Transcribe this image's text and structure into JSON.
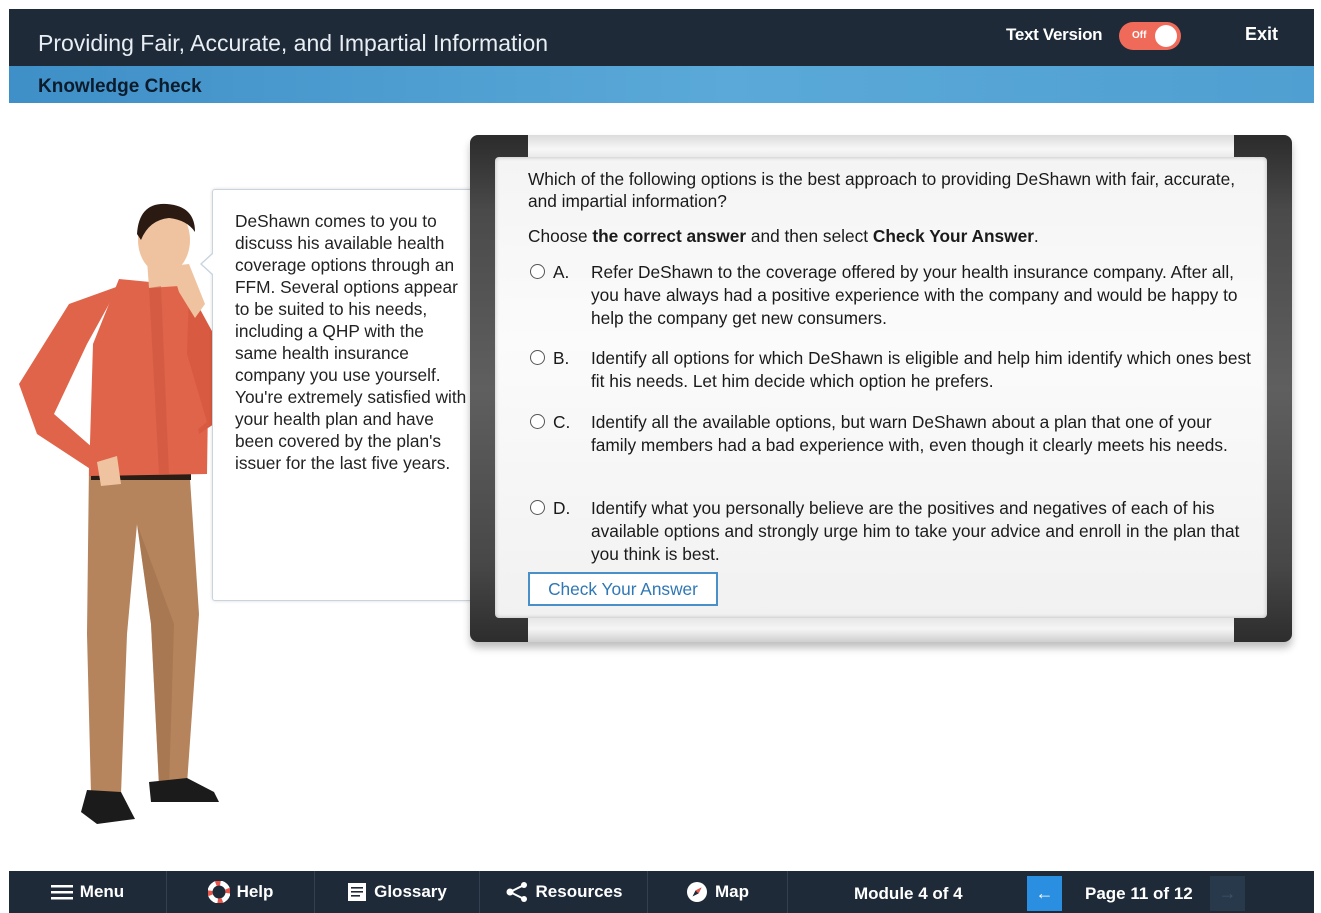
{
  "header": {
    "course_title": "Providing Fair, Accurate, and Impartial Information",
    "text_version_label": "Text Version",
    "toggle_state": "Off",
    "exit_label": "Exit"
  },
  "section": {
    "title": "Knowledge Check"
  },
  "scenario": {
    "text": "DeShawn comes to you to discuss his available health coverage options through an FFM. Several options appear to be suited to his needs, including a QHP with the same health insurance company you use yourself. You're extremely satisfied with your health plan and have been covered by the plan's issuer for the last five years."
  },
  "quiz": {
    "question": "Which of the following options is the best approach to providing DeShawn with fair, accurate, and impartial information?",
    "instruction_pre": "Choose ",
    "instruction_bold1": "the correct answer",
    "instruction_mid": " and then select ",
    "instruction_bold2": "Check Your Answer",
    "instruction_post": ".",
    "options": [
      {
        "letter": "A.",
        "text": "Refer DeShawn to the coverage offered by your health insurance company. After all, you have always had a positive experience with the company and would be happy to help the company get new consumers."
      },
      {
        "letter": "B.",
        "text": "Identify all options for which DeShawn is eligible and help him identify which ones best fit his needs. Let him decide which option he prefers."
      },
      {
        "letter": "C.",
        "text": "Identify all the available options, but warn DeShawn about a plan that one of your family members had a bad experience with, even though it clearly meets his needs."
      },
      {
        "letter": "D.",
        "text": "Identify what you personally believe are the positives and negatives of each of his available options and strongly urge him to take your advice and enroll in the plan that you think is best."
      }
    ],
    "check_button": "Check Your Answer"
  },
  "footer": {
    "menu": "Menu",
    "help": "Help",
    "glossary": "Glossary",
    "resources": "Resources",
    "map": "Map",
    "module": "Module 4 of 4",
    "page": "Page 11 of 12",
    "prev_icon": "left-arrow-icon",
    "next_icon": "right-arrow-icon"
  },
  "colors": {
    "header_bg": "#1e2a38",
    "section_bar": "#4f9fd2",
    "toggle_off": "#f06a5a",
    "accent_button": "#2a8fe0"
  }
}
